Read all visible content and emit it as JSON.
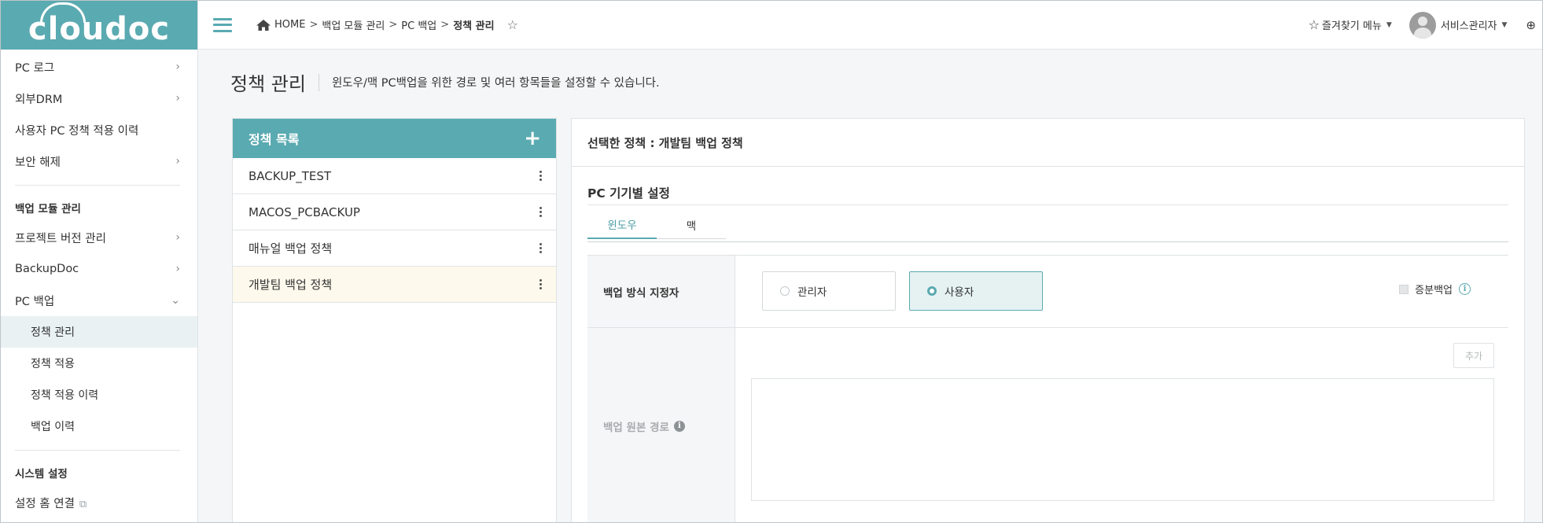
{
  "brand": {
    "logo_text": "cloudoc",
    "accent": "#5aaab1"
  },
  "sidebar": {
    "items": [
      {
        "label": "PC 로그",
        "chevron": "›"
      },
      {
        "label": "외부DRM",
        "chevron": "›"
      },
      {
        "label": "사용자 PC 정책 적용 이력",
        "chevron": ""
      },
      {
        "label": "보안 해제",
        "chevron": "›"
      }
    ],
    "backup_header": "백업 모듈 관리",
    "backup_items": [
      {
        "label": "프로젝트 버전 관리",
        "chevron": "›"
      },
      {
        "label": "BackupDoc",
        "chevron": "›"
      },
      {
        "label": "PC 백업",
        "chevron": "⌄"
      }
    ],
    "pc_backup_sub": [
      {
        "label": "정책 관리"
      },
      {
        "label": "정책 적용"
      },
      {
        "label": "정책 적용 이력"
      },
      {
        "label": "백업 이력"
      }
    ],
    "system_header": "시스템 설정",
    "home_link": "설정 홈 연결"
  },
  "topbar": {
    "breadcrumb": {
      "home": "HOME",
      "sep": ">",
      "level1": "백업 모듈 관리",
      "level2": "PC 백업",
      "current": "정책 관리"
    },
    "favorites_label": "즐겨찾기 메뉴",
    "user_name": "서비스관리자"
  },
  "page": {
    "title": "정책 관리",
    "description": "윈도우/맥 PC백업을 위한 경로 및 여러 항목들을 설정할 수 있습니다."
  },
  "policy_list": {
    "title": "정책 목록",
    "add_symbol": "+",
    "items": [
      {
        "name": "BACKUP_TEST"
      },
      {
        "name": "MACOS_PCBACKUP"
      },
      {
        "name": "매뉴얼 백업 정책"
      },
      {
        "name": "개발팀 백업 정책"
      }
    ]
  },
  "detail": {
    "selected_label": "선택한 정책 : 개발팀 백업 정책",
    "section_title": "PC 기기별 설정",
    "tabs": [
      {
        "label": "윈도우"
      },
      {
        "label": "맥"
      }
    ],
    "backup_method": {
      "label": "백업 방식 지정자",
      "options": [
        {
          "label": "관리자"
        },
        {
          "label": "사용자"
        }
      ],
      "selected": "사용자",
      "incremental_label": "증분백업"
    },
    "source_path": {
      "label": "백업 원본 경로",
      "add_label": "추가"
    }
  }
}
